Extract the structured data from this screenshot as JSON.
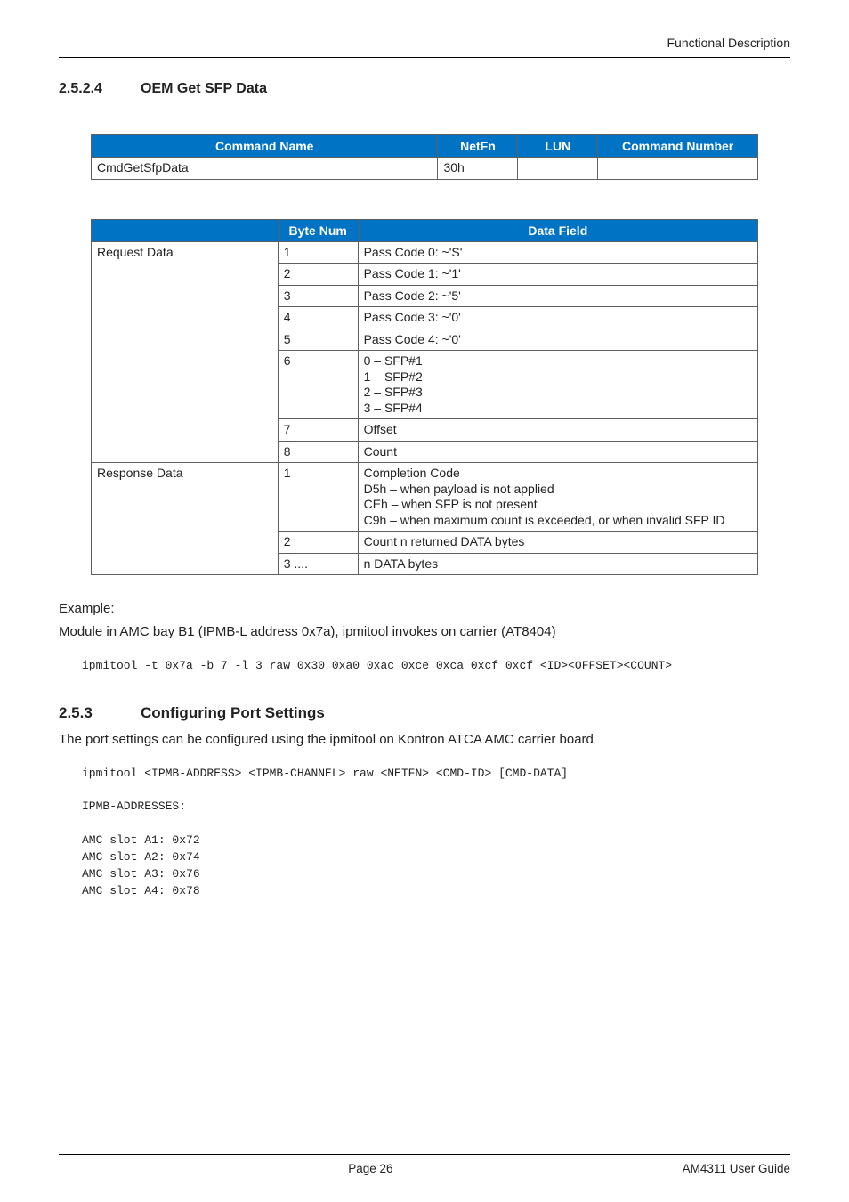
{
  "running_head": "Functional Description",
  "section_a": {
    "num": "2.5.2.4",
    "title": "OEM Get SFP Data"
  },
  "cmd_table": {
    "headers": [
      "Command Name",
      "NetFn",
      "LUN",
      "Command Number"
    ],
    "rows": [
      {
        "name": "CmdGetSfpData",
        "netfn": "30h",
        "lun": "",
        "cmdnum": ""
      }
    ]
  },
  "req_table": {
    "headers": [
      "",
      "Byte Num",
      "Data Field"
    ],
    "groups": [
      {
        "label": "Request Data",
        "rows": [
          {
            "byte": "1",
            "field": "Pass Code 0: ~'S'"
          },
          {
            "byte": "2",
            "field": "Pass Code 1: ~'1'"
          },
          {
            "byte": "3",
            "field": "Pass Code 2: ~'5'"
          },
          {
            "byte": "4",
            "field": "Pass Code 3: ~'0'"
          },
          {
            "byte": "5",
            "field": "Pass Code 4: ~'0'"
          },
          {
            "byte": "6",
            "field": "0 – SFP#1\n1 – SFP#2\n2 – SFP#3\n3 – SFP#4"
          },
          {
            "byte": "7",
            "field": "Offset"
          },
          {
            "byte": "8",
            "field": "Count"
          }
        ]
      },
      {
        "label": "Response Data",
        "rows": [
          {
            "byte": "1",
            "field": "Completion Code\nD5h – when payload is not applied\nCEh – when SFP is not present\nC9h – when maximum count is exceeded, or when invalid SFP ID"
          },
          {
            "byte": "2",
            "field": "Count n returned DATA bytes"
          },
          {
            "byte": "3 ....",
            "field": "n DATA bytes"
          }
        ]
      }
    ]
  },
  "example_label": "Example:",
  "example_text": "Module in AMC bay B1 (IPMB-L address 0x7a), ipmitool invokes on carrier (AT8404)",
  "example_code": "ipmitool -t 0x7a -b 7 -l 3 raw 0x30 0xa0 0xac 0xce 0xca 0xcf 0xcf <ID><OFFSET><COUNT>",
  "section_b": {
    "num": "2.5.3",
    "title": "Configuring Port Settings"
  },
  "port_intro": "The port settings can be configured using the ipmitool on Kontron ATCA AMC carrier board",
  "port_code": "ipmitool <IPMB-ADDRESS> <IPMB-CHANNEL> raw <NETFN> <CMD-ID> [CMD-DATA]\n\nIPMB-ADDRESSES:\n\nAMC slot A1: 0x72\nAMC slot A2: 0x74\nAMC slot A3: 0x76\nAMC slot A4: 0x78",
  "footer": {
    "left": "",
    "center": "Page 26",
    "right": "AM4311 User Guide"
  }
}
